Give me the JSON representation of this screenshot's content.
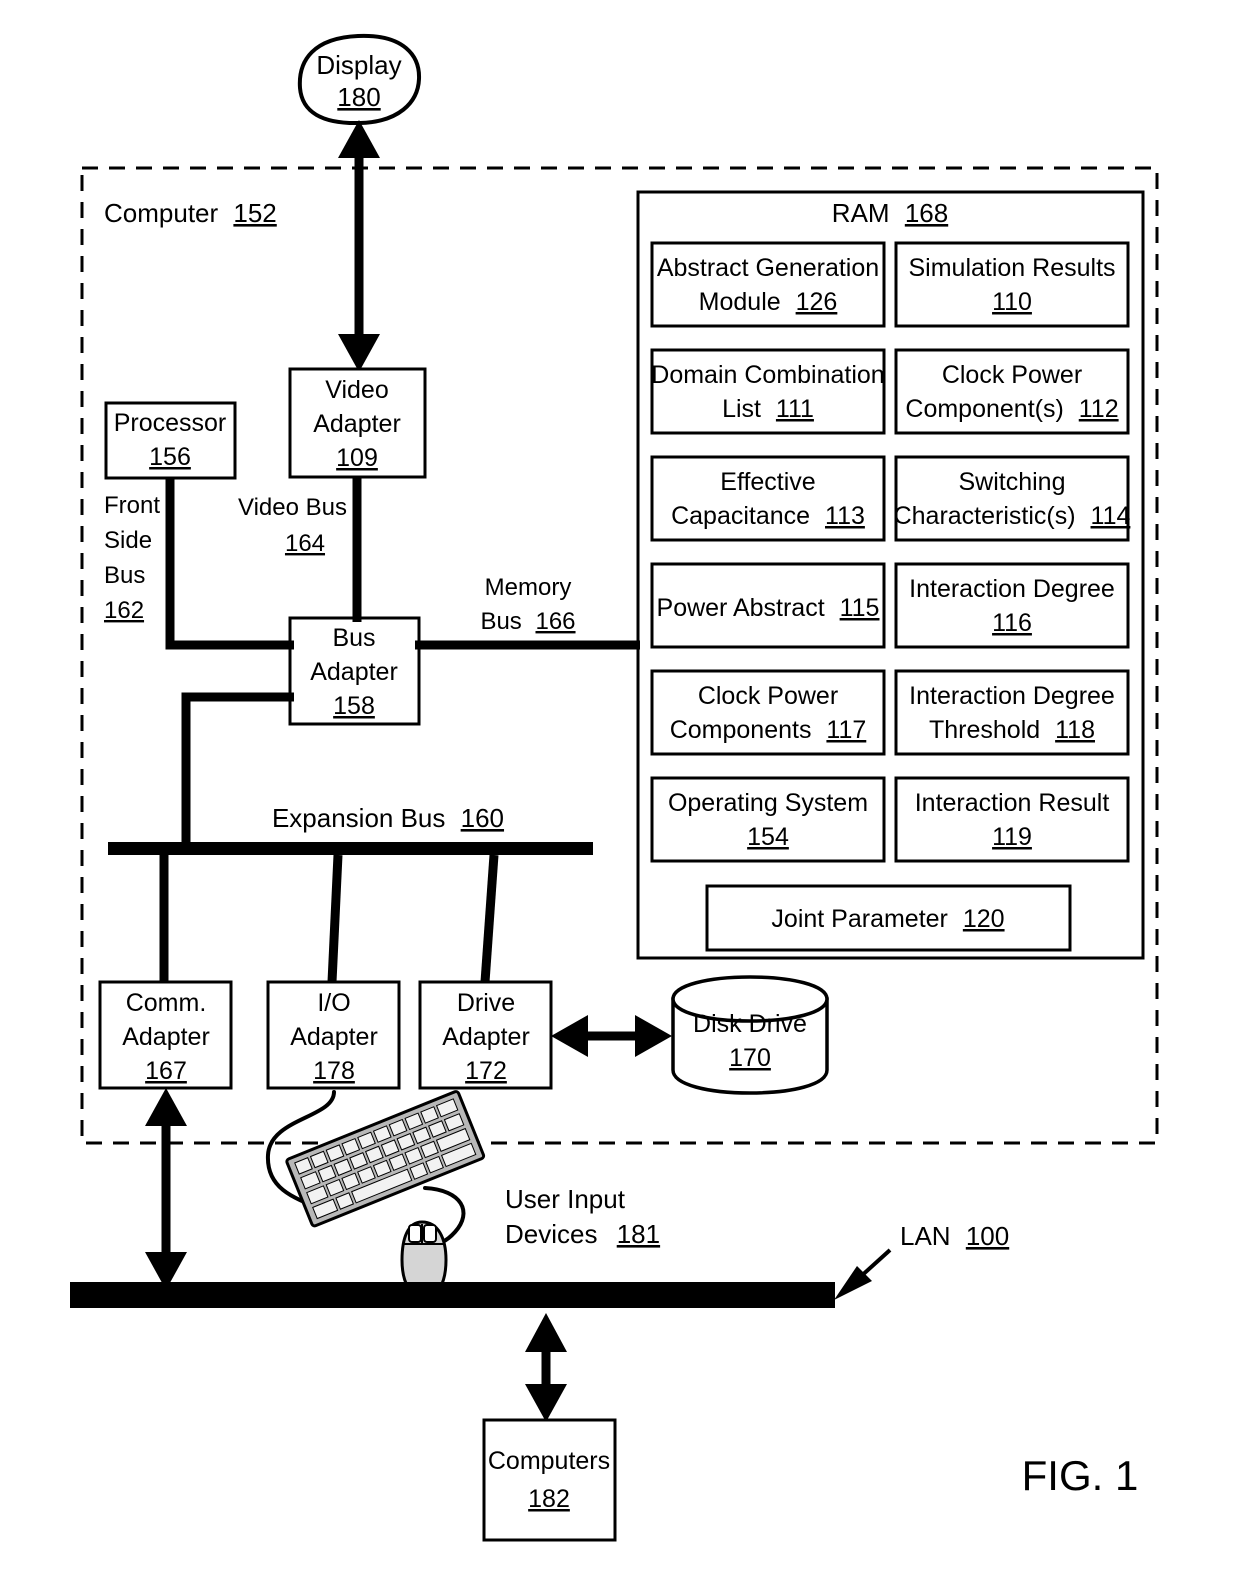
{
  "figure": {
    "label": "FIG. 1",
    "title_node": {
      "name": "display-node",
      "line1": "Display",
      "line2": "180"
    },
    "enclosure": {
      "name": "computer-enclosure",
      "label_text": "Computer",
      "label_ref": "152"
    },
    "ram": {
      "title_text": "RAM",
      "title_ref": "168",
      "modules": [
        {
          "line1": "Abstract Generation",
          "line2": "Module",
          "ref": "126",
          "column": "left"
        },
        {
          "line1": "Simulation Results",
          "line2": "",
          "ref": "110",
          "column": "right"
        },
        {
          "line1": "Domain Combination",
          "line2": "List",
          "ref": "111",
          "column": "left"
        },
        {
          "line1": "Clock Power",
          "line2": "Component(s)",
          "ref": "112",
          "column": "right"
        },
        {
          "line1": "Effective",
          "line2": "Capacitance",
          "ref": "113",
          "column": "left"
        },
        {
          "line1": "Switching",
          "line2": "Characteristic(s)",
          "ref": "114",
          "column": "right"
        },
        {
          "line1": "Power Abstract",
          "line2": "",
          "ref": "115",
          "column": "left"
        },
        {
          "line1": "Interaction Degree",
          "line2": "",
          "ref": "116",
          "column": "right"
        },
        {
          "line1": "Clock Power",
          "line2": "Components",
          "ref": "117",
          "column": "left"
        },
        {
          "line1": "Interaction Degree",
          "line2": "Threshold",
          "ref": "118",
          "column": "right"
        },
        {
          "line1": "Operating System",
          "line2": "",
          "ref": "154",
          "column": "left"
        },
        {
          "line1": "Interaction Result",
          "line2": "",
          "ref": "119",
          "column": "right"
        }
      ],
      "wide_module": {
        "line1": "Joint Parameter",
        "ref": "120"
      }
    },
    "components": {
      "processor": {
        "line1": "Processor",
        "ref": "156"
      },
      "video_adapter": {
        "line1": "Video",
        "line2": "Adapter",
        "ref": "109"
      },
      "bus_adapter": {
        "line1": "Bus",
        "line2": "Adapter",
        "ref": "158"
      },
      "comm_adapter": {
        "line1": "Comm.",
        "line2": "Adapter",
        "ref": "167"
      },
      "io_adapter": {
        "line1": "I/O",
        "line2": "Adapter",
        "ref": "178"
      },
      "drive_adapter": {
        "line1": "Drive",
        "line2": "Adapter",
        "ref": "172"
      },
      "disk_drive": {
        "line1": "Disk Drive",
        "ref": "170"
      },
      "computers": {
        "line1": "Computers",
        "ref": "182"
      }
    },
    "buses": {
      "front_side_bus": {
        "line1": "Front",
        "line2": "Side",
        "line3": "Bus",
        "ref": "162"
      },
      "video_bus": {
        "line1": "Video Bus",
        "ref": "164"
      },
      "memory_bus": {
        "line1": "Memory",
        "line2": "Bus",
        "ref": "166"
      },
      "expansion_bus": {
        "line1": "Expansion Bus",
        "ref": "160"
      },
      "lan": {
        "line1": "LAN",
        "ref": "100"
      }
    },
    "user_input": {
      "line1": "User Input",
      "line2": "Devices",
      "ref": "181"
    },
    "colors": {
      "ink": "#000000",
      "paper": "#ffffff",
      "keyboard_fill": "#b8b8b8",
      "mouse_fill": "#d5d5d5"
    }
  }
}
